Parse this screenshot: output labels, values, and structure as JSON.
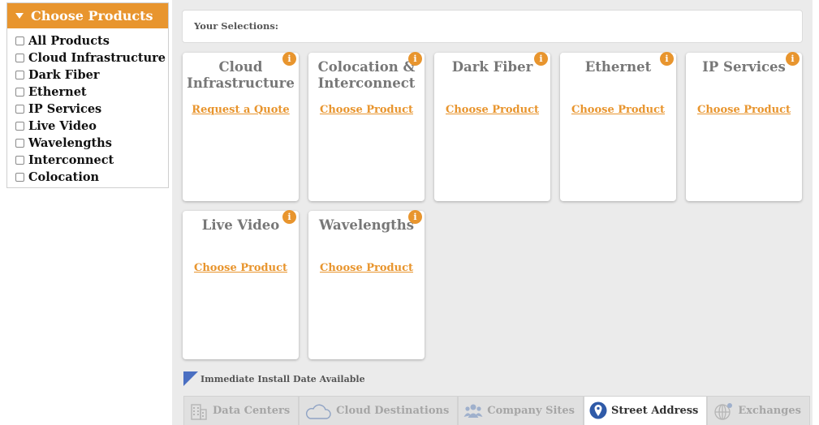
{
  "sidebar": {
    "title": "Choose Products",
    "items": [
      {
        "label": "All Products"
      },
      {
        "label": "Cloud Infrastructure"
      },
      {
        "label": "Dark Fiber"
      },
      {
        "label": "Ethernet"
      },
      {
        "label": "IP Services"
      },
      {
        "label": "Live Video"
      },
      {
        "label": "Wavelengths"
      },
      {
        "label": "Interconnect"
      },
      {
        "label": "Colocation"
      }
    ]
  },
  "selections": {
    "label": "Your Selections:"
  },
  "cards": [
    {
      "title_line1": "Cloud",
      "title_line2": "Infrastructure",
      "link": "Request a Quote",
      "info": "i"
    },
    {
      "title_line1": "Colocation &",
      "title_line2": "Interconnect",
      "link": "Choose Product",
      "info": "i"
    },
    {
      "title_line1": "Dark Fiber",
      "title_line2": "",
      "link": "Choose Product",
      "info": "i"
    },
    {
      "title_line1": "Ethernet",
      "title_line2": "",
      "link": "Choose Product",
      "info": "i"
    },
    {
      "title_line1": "IP Services",
      "title_line2": "",
      "link": "Choose Product",
      "info": "i"
    },
    {
      "title_line1": "Live Video",
      "title_line2": "",
      "link": "Choose Product",
      "info": "i"
    },
    {
      "title_line1": "Wavelengths",
      "title_line2": "",
      "link": "Choose Product",
      "info": "i"
    }
  ],
  "legend": {
    "text": "Immediate Install Date Available",
    "color": "#4a6fc2"
  },
  "tabs": [
    {
      "label": "Data Centers",
      "icon": "building-icon"
    },
    {
      "label": "Cloud Destinations",
      "icon": "cloud-icon"
    },
    {
      "label": "Company Sites",
      "icon": "people-icon"
    },
    {
      "label": "Street Address",
      "icon": "map-pin-icon",
      "active": true
    },
    {
      "label": "Exchanges",
      "icon": "globe-icon"
    }
  ],
  "colors": {
    "accent": "#e8952e",
    "panel": "#ebebeb",
    "pin": "#2f5aa8"
  }
}
